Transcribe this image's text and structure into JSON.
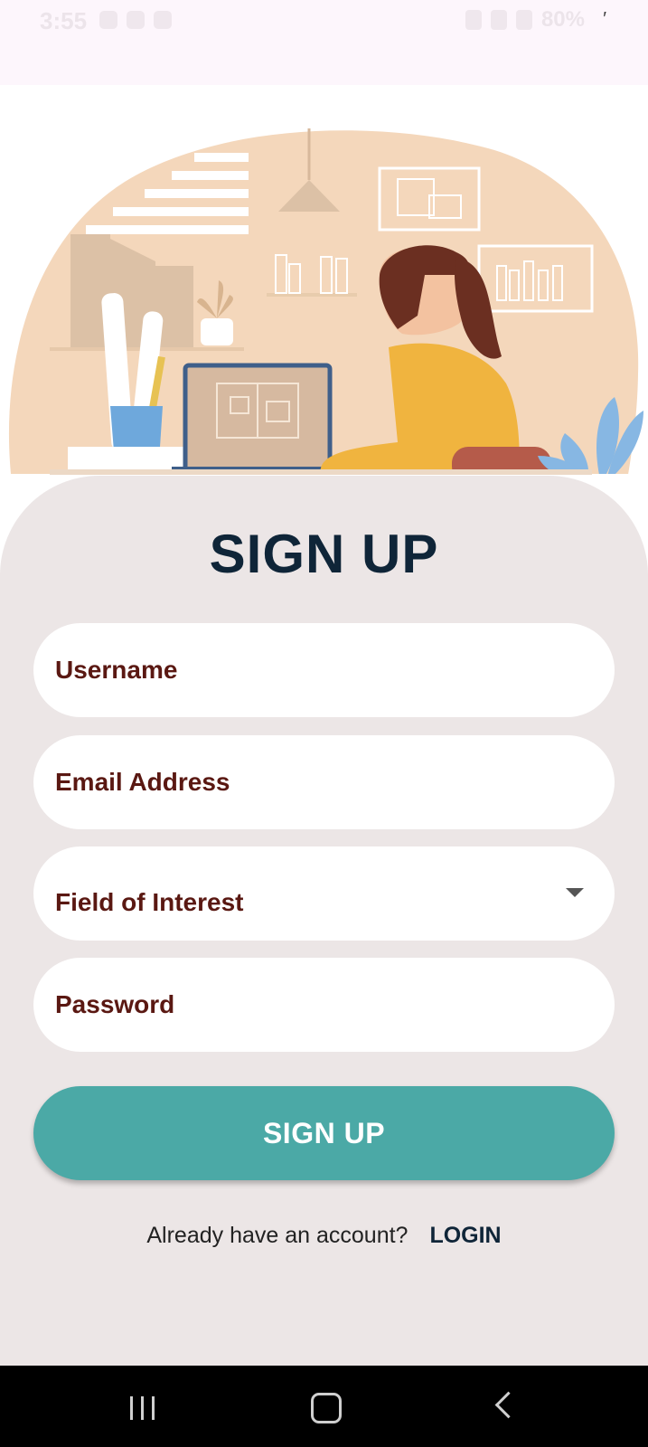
{
  "status_bar": {
    "time": "3:55",
    "battery": "80%"
  },
  "title": "SIGN UP",
  "form": {
    "username_placeholder": "Username",
    "email_placeholder": "Email Address",
    "interest_placeholder": "Field of Interest",
    "password_placeholder": "Password"
  },
  "signup_button": "SIGN UP",
  "login_prompt": "Already have an account?",
  "login_link": "LOGIN",
  "colors": {
    "accent": "#4ba9a6",
    "title": "#0f2538",
    "field_text": "#5a1812",
    "card_bg": "#ece6e6"
  },
  "nav": {
    "recent_icon": "recent-apps-icon",
    "home_icon": "home-icon",
    "back_icon": "back-icon"
  }
}
